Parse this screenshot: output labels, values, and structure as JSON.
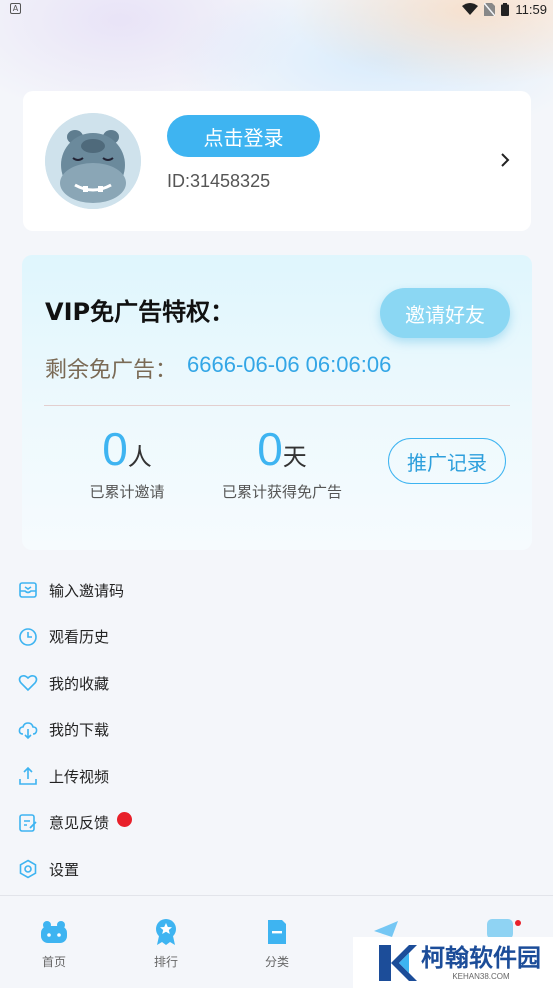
{
  "status_bar": {
    "left_badge": "A",
    "time": "11:59"
  },
  "profile": {
    "login_label": "点击登录",
    "user_id": "ID:31458325"
  },
  "vip": {
    "title": "VIP免广告特权：",
    "invite_label": "邀请好友",
    "remaining_label": "剩余免广告：",
    "remaining_value": "6666-06-06 06:06:06",
    "invited_count": "0",
    "invited_unit": "人",
    "invited_caption": "已累计邀请",
    "days_count": "0",
    "days_unit": "天",
    "days_caption": "已累计获得免广告",
    "record_label": "推广记录"
  },
  "menu": [
    {
      "label": "输入邀请码",
      "icon": "invite-code-icon"
    },
    {
      "label": "观看历史",
      "icon": "clock-icon"
    },
    {
      "label": "我的收藏",
      "icon": "heart-icon"
    },
    {
      "label": "我的下载",
      "icon": "cloud-download-icon"
    },
    {
      "label": "上传视频",
      "icon": "upload-icon"
    },
    {
      "label": "意见反馈",
      "icon": "feedback-icon",
      "badge": true
    },
    {
      "label": "设置",
      "icon": "settings-icon"
    }
  ],
  "tabbar": [
    {
      "label": "首页",
      "icon": "hippo-home-icon"
    },
    {
      "label": "排行",
      "icon": "ranking-badge-icon"
    },
    {
      "label": "分类",
      "icon": "category-icon"
    }
  ],
  "watermark": {
    "title": "柯翰软件园",
    "sub": "KEHAN38.COM"
  },
  "colors": {
    "accent": "#3eb4f1",
    "badge_red": "#e8202a"
  }
}
